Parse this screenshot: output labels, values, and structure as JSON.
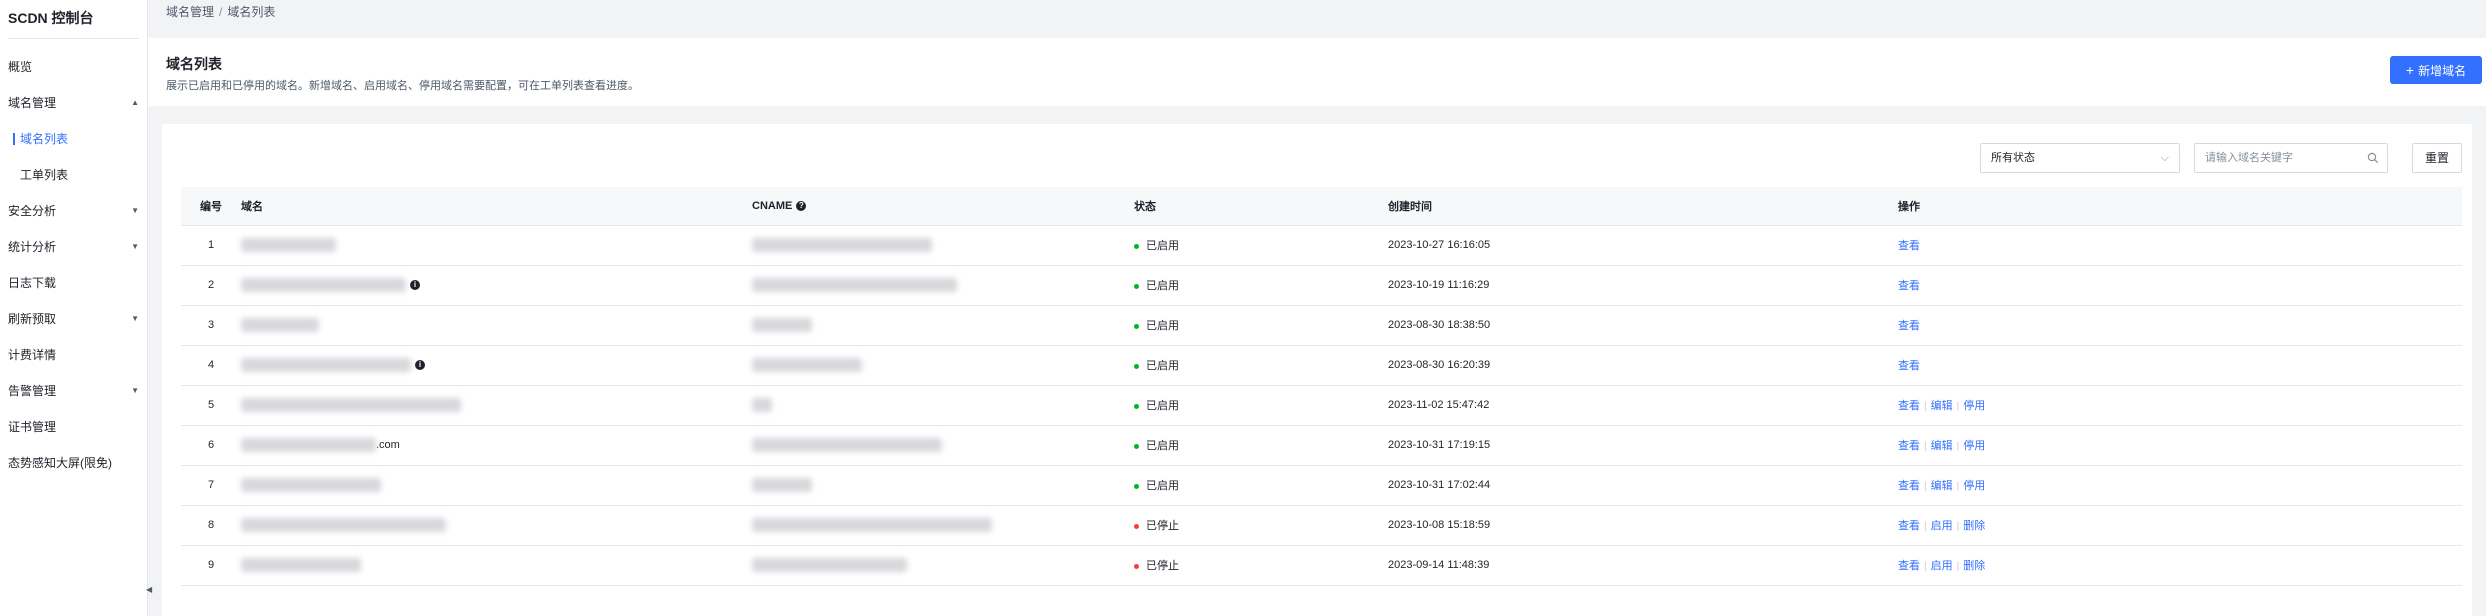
{
  "sidebar": {
    "title": "SCDN 控制台",
    "items": [
      {
        "label": "概览",
        "arrow": ""
      },
      {
        "label": "域名管理",
        "arrow": "▲"
      },
      {
        "label": "域名列表",
        "arrow": ""
      },
      {
        "label": "工单列表",
        "arrow": ""
      },
      {
        "label": "安全分析",
        "arrow": "▼"
      },
      {
        "label": "统计分析",
        "arrow": "▼"
      },
      {
        "label": "日志下载",
        "arrow": ""
      },
      {
        "label": "刷新预取",
        "arrow": "▼"
      },
      {
        "label": "计费详情",
        "arrow": ""
      },
      {
        "label": "告警管理",
        "arrow": "▼"
      },
      {
        "label": "证书管理",
        "arrow": ""
      },
      {
        "label": "态势感知大屏(限免)",
        "arrow": ""
      }
    ],
    "collapse_glyph": "◀"
  },
  "breadcrumb": {
    "parent": "域名管理",
    "separator": "/",
    "current": "域名列表"
  },
  "header": {
    "title": "域名列表",
    "description": "展示已启用和已停用的域名。新增域名、启用域名、停用域名需要配置，可在工单列表查看进度。",
    "add_button": "新增域名"
  },
  "filters": {
    "status_value": "所有状态",
    "search_placeholder": "请输入域名关键字",
    "reset_button": "重置"
  },
  "table": {
    "columns": {
      "index": "编号",
      "domain": "域名",
      "cname": "CNAME",
      "status": "状态",
      "created": "创建时间",
      "actions": "操作"
    },
    "rows": [
      {
        "index": "1",
        "domain_visible": "",
        "cname_visible": "",
        "status": "已启用",
        "status_color": "#00b42a",
        "created": "2023-10-27 16:16:05",
        "actions": [
          "查看"
        ]
      },
      {
        "index": "2",
        "domain_visible": "",
        "cname_visible": "",
        "status": "已启用",
        "status_color": "#00b42a",
        "created": "2023-10-19 11:16:29",
        "actions": [
          "查看"
        ]
      },
      {
        "index": "3",
        "domain_visible": "",
        "cname_visible": "",
        "status": "已启用",
        "status_color": "#00b42a",
        "created": "2023-08-30 18:38:50",
        "actions": [
          "查看"
        ]
      },
      {
        "index": "4",
        "domain_visible": "",
        "cname_visible": "",
        "status": "已启用",
        "status_color": "#00b42a",
        "created": "2023-08-30 16:20:39",
        "actions": [
          "查看"
        ]
      },
      {
        "index": "5",
        "domain_visible": "",
        "cname_visible": "",
        "status": "已启用",
        "status_color": "#00b42a",
        "created": "2023-11-02 15:47:42",
        "actions": [
          "查看",
          "编辑",
          "停用"
        ]
      },
      {
        "index": "6",
        "domain_visible": ".com",
        "cname_visible": "",
        "status": "已启用",
        "status_color": "#00b42a",
        "created": "2023-10-31 17:19:15",
        "actions": [
          "查看",
          "编辑",
          "停用"
        ]
      },
      {
        "index": "7",
        "domain_visible": "",
        "cname_visible": "",
        "status": "已启用",
        "status_color": "#00b42a",
        "created": "2023-10-31 17:02:44",
        "actions": [
          "查看",
          "编辑",
          "停用"
        ]
      },
      {
        "index": "8",
        "domain_visible": "",
        "cname_visible": "",
        "status": "已停止",
        "status_color": "#f53f3f",
        "created": "2023-10-08 15:18:59",
        "actions": [
          "查看",
          "启用",
          "删除"
        ]
      },
      {
        "index": "9",
        "domain_visible": "",
        "cname_visible": "",
        "status": "已停止",
        "status_color": "#f53f3f",
        "created": "2023-09-14 11:48:39",
        "actions": [
          "查看",
          "启用",
          "删除"
        ]
      }
    ]
  },
  "icons": {
    "cname_help": "question-circle-icon",
    "domain_info": "info-icon",
    "search": "search-icon",
    "status_chevron": "chevron-down-icon",
    "add": "plus-icon"
  },
  "colors": {
    "accent": "#3370ff",
    "enabled": "#00b42a",
    "stopped": "#f53f3f"
  }
}
